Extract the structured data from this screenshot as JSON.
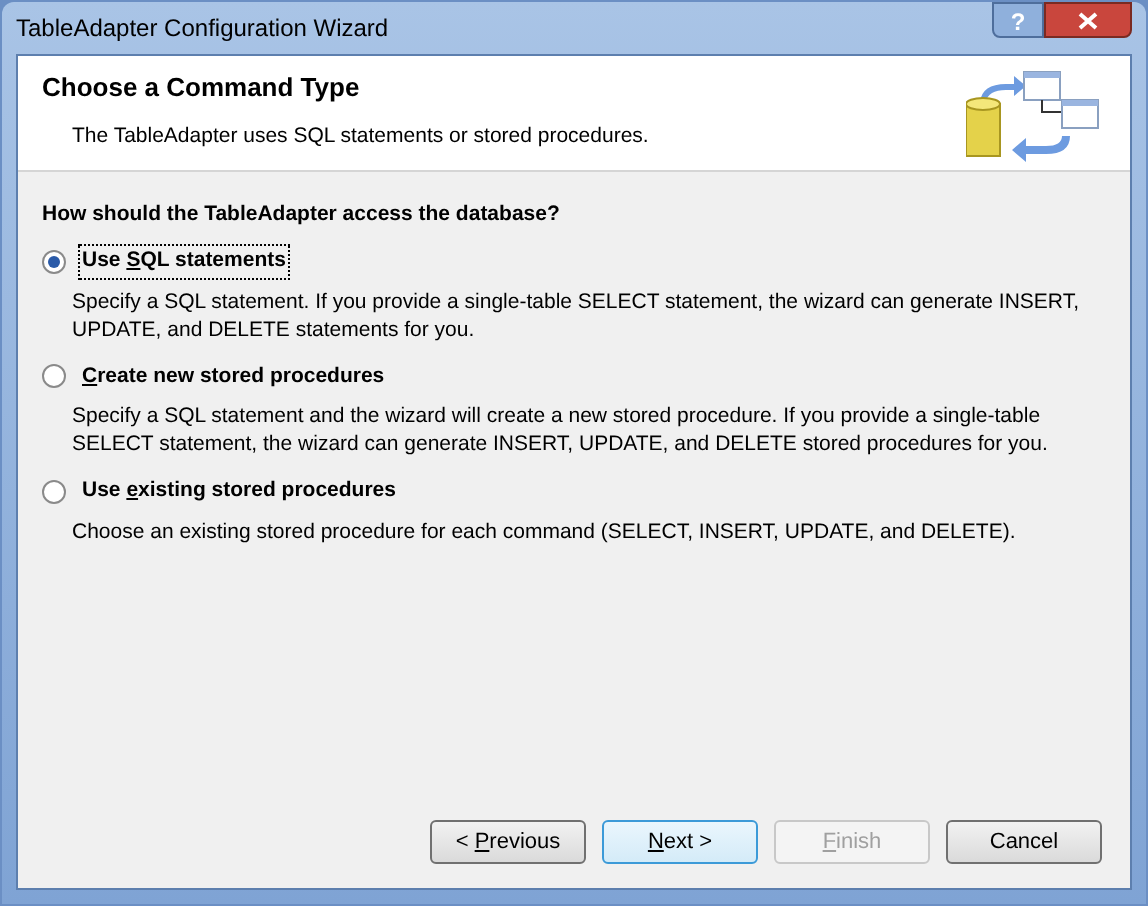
{
  "window": {
    "title": "TableAdapter Configuration Wizard",
    "help_glyph": "?"
  },
  "header": {
    "title": "Choose a Command Type",
    "subtitle": "The TableAdapter uses SQL statements or stored procedures."
  },
  "question": "How should the TableAdapter access the database?",
  "options": [
    {
      "label": {
        "before": "Use ",
        "key": "S",
        "after": "QL statements"
      },
      "description": "Specify a SQL statement. If you provide a single-table SELECT statement, the wizard can generate INSERT, UPDATE, and DELETE statements for you.",
      "selected": true
    },
    {
      "label": {
        "key": "C",
        "after": "reate new stored procedures"
      },
      "description": "Specify a SQL statement and the wizard will create a new stored procedure. If you provide a single-table SELECT statement, the wizard can generate INSERT, UPDATE, and DELETE stored procedures for you.",
      "selected": false
    },
    {
      "label": {
        "before": "Use ",
        "key": "e",
        "after": "xisting stored procedures"
      },
      "description": "Choose an existing stored procedure for each command (SELECT, INSERT, UPDATE, and DELETE).",
      "selected": false
    }
  ],
  "buttons": [
    {
      "label": {
        "before": "< ",
        "key": "P",
        "after": "revious"
      },
      "disabled": false,
      "default": false
    },
    {
      "label": {
        "key": "N",
        "after": "ext >"
      },
      "disabled": false,
      "default": true
    },
    {
      "label": {
        "key": "F",
        "after": "inish"
      },
      "disabled": true,
      "default": false
    },
    {
      "label": {
        "before": "Cancel"
      },
      "disabled": false,
      "default": false
    }
  ]
}
